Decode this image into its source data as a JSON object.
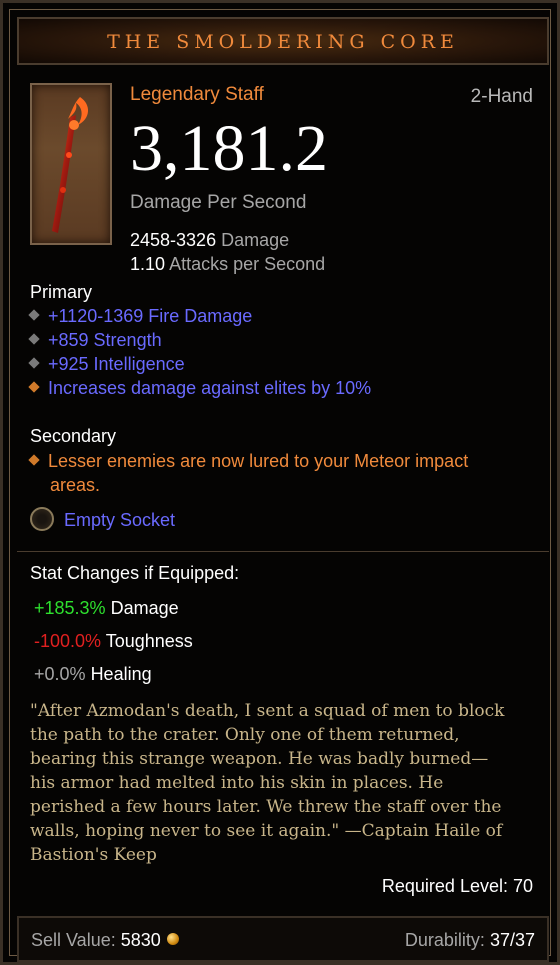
{
  "item": {
    "name": "THE SMOLDERING CORE",
    "type": "Legendary Staff",
    "slot": "2-Hand",
    "icon": "fire-staff-icon",
    "dps": "3,181.2",
    "dps_label": "Damage Per Second",
    "damage_range": "2458-3326",
    "damage_label": "Damage",
    "attack_speed": "1.10",
    "attack_speed_label": "Attacks per Second"
  },
  "primary": {
    "label": "Primary",
    "affixes": [
      "+1120-1369 Fire Damage",
      "+859 Strength",
      "+925 Intelligence",
      "Increases damage against elites by 10%"
    ]
  },
  "secondary": {
    "label": "Secondary",
    "affix_line1": "Lesser enemies are now lured to your Meteor impact",
    "affix_line2": "areas."
  },
  "socket": {
    "label": "Empty Socket"
  },
  "stat_changes": {
    "title": "Stat Changes if Equipped:",
    "rows": [
      {
        "value": "+185.3%",
        "label": "Damage"
      },
      {
        "value": "-100.0%",
        "label": "Toughness"
      },
      {
        "value": "+0.0%",
        "label": "Healing"
      }
    ]
  },
  "flavor_lines": [
    "\"After Azmodan's death, I sent a squad of men to block",
    "the path to the crater. Only one of them returned,",
    "bearing this strange weapon. He was badly burned—",
    "his armor had melted into his skin in places. He",
    "perished a few hours later. We threw the staff over the",
    "walls, hoping never to see it again.\" —Captain Haile of",
    "Bastion's Keep"
  ],
  "required_level": "Required Level: 70",
  "footer": {
    "sell_label": "Sell Value:",
    "sell_value": "5830",
    "durability_label": "Durability:",
    "durability_value": "37/37"
  },
  "colors": {
    "legendary": "#f08a3c",
    "magic": "#6a6aff",
    "positive": "#2ee02e",
    "negative": "#e02020",
    "flavor": "#c8b58a"
  }
}
